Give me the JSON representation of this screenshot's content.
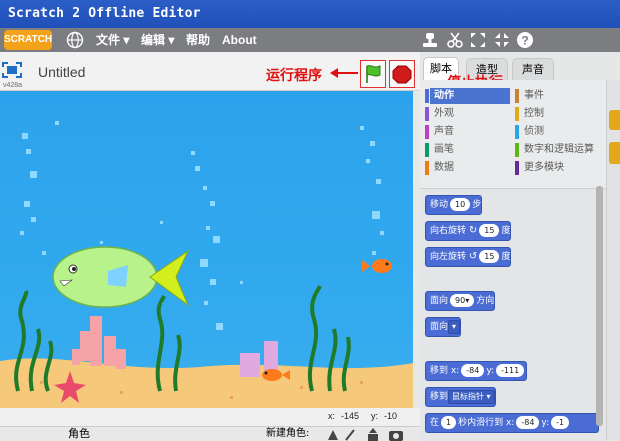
{
  "window": {
    "title": "Scratch 2 Offline Editor"
  },
  "menubar": {
    "logo_text": "SCRATCH",
    "items": [
      "文件 ▾",
      "编辑 ▾",
      "帮助",
      "About"
    ],
    "tools": [
      "stamp-icon",
      "cut-icon",
      "grow-icon",
      "shrink-icon",
      "help-icon"
    ]
  },
  "stage_header": {
    "project_title": "Untitled",
    "version": "v428a",
    "run_annotation": "运行程序",
    "stop_annotation": "停止执行"
  },
  "coords": {
    "x_label": "x:",
    "x_value": "-145",
    "y_label": "y:",
    "y_value": "-10"
  },
  "sprite_bar": {
    "label": "角色",
    "new_sprite": "新建角色:"
  },
  "tabs": [
    "脚本",
    "造型",
    "声音"
  ],
  "categories": [
    {
      "label": "动作",
      "color": "#4a6cd4",
      "active": true
    },
    {
      "label": "事件",
      "color": "#c88330"
    },
    {
      "label": "外观",
      "color": "#8a55d7"
    },
    {
      "label": "控制",
      "color": "#e1a91a"
    },
    {
      "label": "声音",
      "color": "#bb42c3"
    },
    {
      "label": "侦测",
      "color": "#2ca5e2"
    },
    {
      "label": "画笔",
      "color": "#0e9a6c"
    },
    {
      "label": "数字和逻辑运算",
      "color": "#5cb712"
    },
    {
      "label": "数据",
      "color": "#ee7d16"
    },
    {
      "label": "更多模块",
      "color": "#632d99"
    }
  ],
  "blocks": {
    "move": {
      "pre": "移动",
      "val": "10",
      "post": "步"
    },
    "turn_right": {
      "pre": "向右旋转",
      "val": "15",
      "post": "度"
    },
    "turn_left": {
      "pre": "向左旋转",
      "val": "15",
      "post": "度"
    },
    "point_dir": {
      "pre": "面向",
      "val": "90▾",
      "post": "方向"
    },
    "point_towards": {
      "pre": "面向",
      "val": "▾"
    },
    "goto_xy": {
      "pre": "移到 x:",
      "x": "-84",
      "mid": "y:",
      "y": "-111"
    },
    "goto": {
      "pre": "移到",
      "val": "鼠标指针 ▾"
    },
    "glide": {
      "pre": "在",
      "secs": "1",
      "mid": "秒内滑行到 x:",
      "x": "-84",
      "ylabel": "y:",
      "y": "-1"
    }
  },
  "colors": {
    "accent": "#e01010",
    "motion": "#4a6cd4",
    "stage": "#2da2ec"
  }
}
